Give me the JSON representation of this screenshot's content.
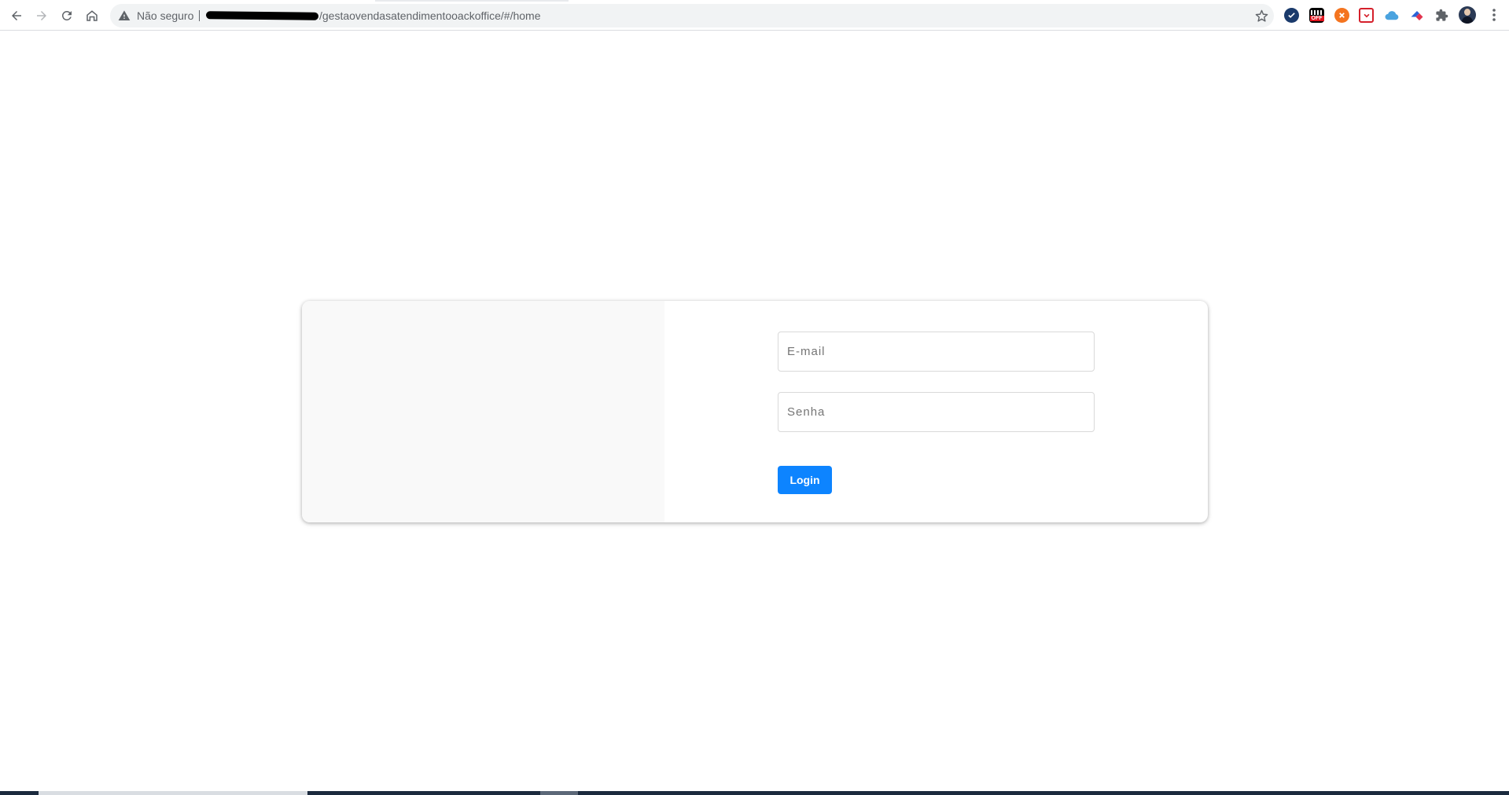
{
  "browser": {
    "security_label": "Não seguro",
    "url_visible": "/gestaovendasatendimentooackoffice/#/home"
  },
  "extensions": [
    {
      "name": "check-extension-icon",
      "color": "#1a3a6b"
    },
    {
      "name": "off-extension-icon",
      "color": "#000000",
      "text": "OFF"
    },
    {
      "name": "orange-extension-icon",
      "color": "#f4741f"
    },
    {
      "name": "pocket-extension-icon",
      "color": "#d5202b"
    },
    {
      "name": "cloud-extension-icon",
      "color": "#4aa3df"
    },
    {
      "name": "arrow-extension-icon",
      "color": "#2a63d6"
    }
  ],
  "login": {
    "email_placeholder": "E-mail",
    "password_placeholder": "Senha",
    "button_label": "Login",
    "button_color": "#0d84ff"
  }
}
